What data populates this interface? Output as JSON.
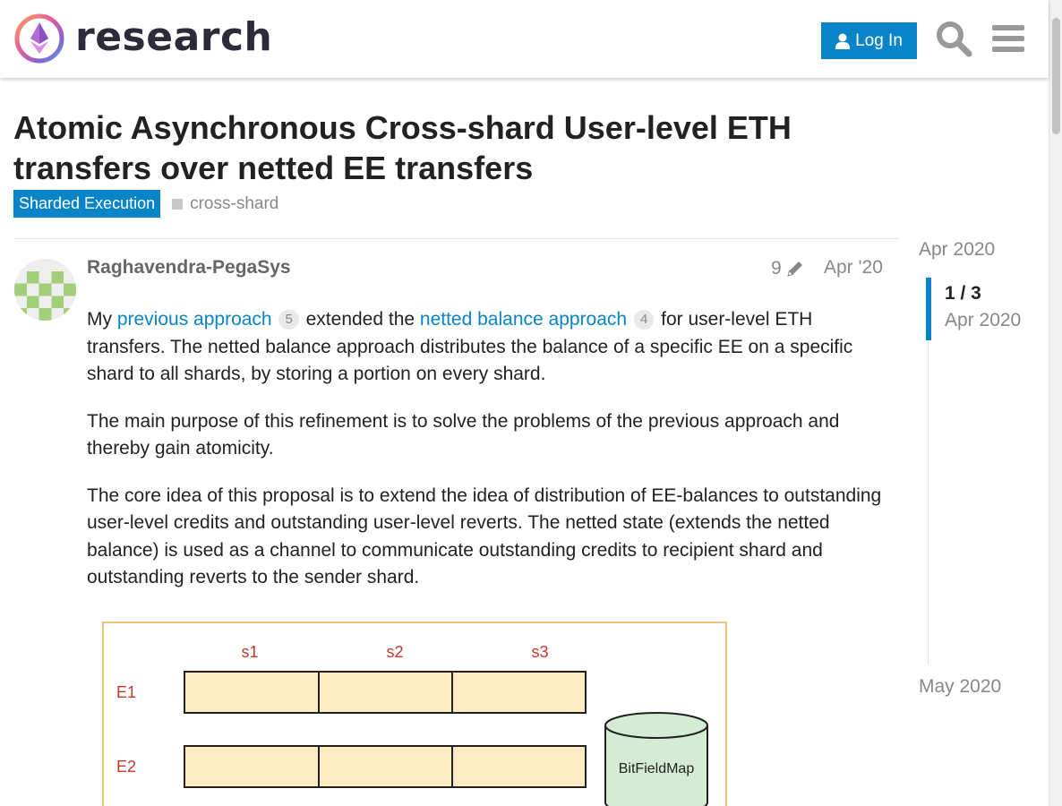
{
  "header": {
    "site_name": "research",
    "login_label": "Log In"
  },
  "topic": {
    "title": "Atomic Asynchronous Cross-shard User-level ETH transfers over netted EE transfers",
    "category": "Sharded Execution",
    "tags": [
      "cross-shard"
    ]
  },
  "post": {
    "username": "Raghavendra-PegaSys",
    "edit_count": "9",
    "date": "Apr '20",
    "p1": {
      "t1": "My ",
      "link1": "previous approach",
      "link1_clicks": "5",
      "t2": " extended the ",
      "link2": "netted balance approach",
      "link2_clicks": "4",
      "t3": " for user-level ETH transfers. The netted balance approach distributes the balance of a specific EE on a specific shard to all shards, by storing a portion on every shard."
    },
    "p2": "The main purpose of this refinement is to solve the problems of the previous approach and thereby gain atomicity.",
    "p3": "The core idea of this proposal is to extend the idea of distribution of EE-balances to outstanding user-level credits and outstanding user-level reverts. The netted state (extends the netted balance) is used as a channel to communicate outstanding credits to recipient shard and outstanding reverts to the sender shard.",
    "diagram": {
      "col_labels": [
        "s1",
        "s2",
        "s3"
      ],
      "row_labels": [
        "E1",
        "E2"
      ],
      "store_label": "BitFieldMap"
    }
  },
  "timeline": {
    "start": "Apr 2020",
    "position": "1 / 3",
    "position_date": "Apr 2020",
    "end": "May 2020"
  },
  "colors": {
    "accent": "#0a84c8",
    "cell_fill": "#fdebc4",
    "store_fill": "#d5ecd4",
    "label_red": "#c0392b"
  }
}
